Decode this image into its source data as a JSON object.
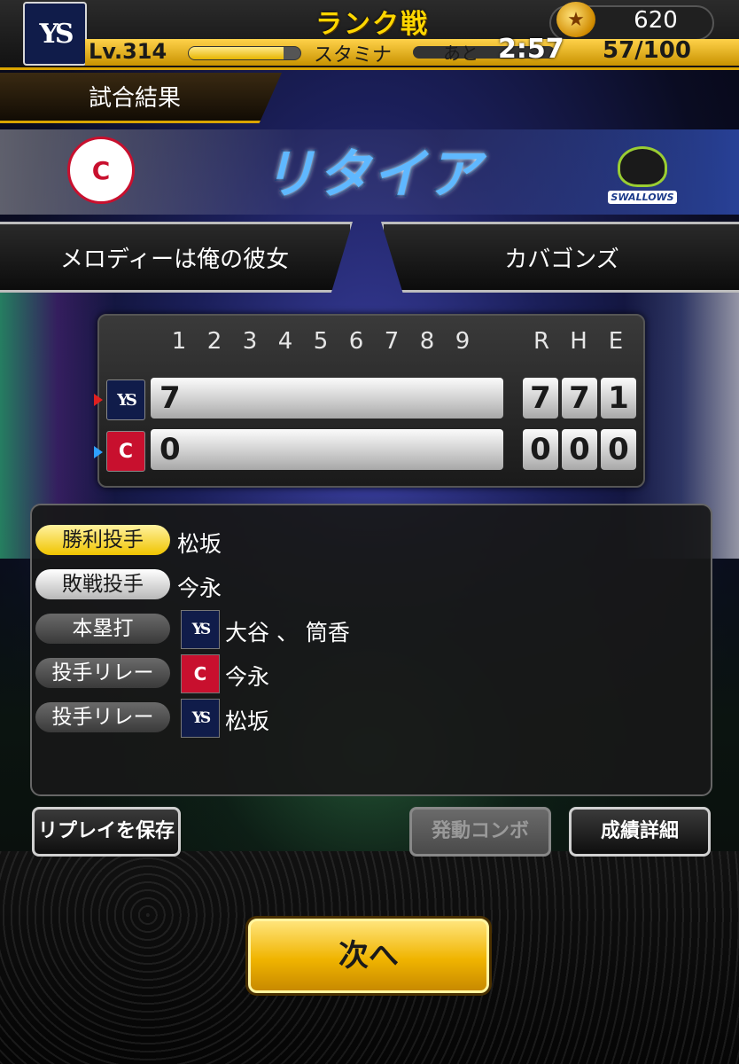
{
  "header": {
    "team_badge": "YS",
    "mode_title": "ランク戦",
    "coins": "620",
    "level_label": "Lv.314",
    "level_progress": 0.85,
    "stamina_label": "スタミナ",
    "stamina_remaining_label": "あと",
    "stamina_timer": "2:57",
    "stamina_count": "57/100"
  },
  "result": {
    "tab_label": "試合結果",
    "result_text": "リタイア",
    "home_team": "メロディーは俺の彼女",
    "away_team": "カバゴンズ",
    "carp_logo": "C",
    "swallows_logo_text": "SWALLOWS"
  },
  "scoreboard": {
    "innings": [
      "1",
      "2",
      "3",
      "4",
      "5",
      "6",
      "7",
      "8",
      "9"
    ],
    "rhe_headers": [
      "R",
      "H",
      "E"
    ],
    "rows": [
      {
        "logo": "YS",
        "line": "7",
        "rhe": [
          "7",
          "7",
          "1"
        ]
      },
      {
        "logo": "C",
        "line": "0",
        "rhe": [
          "0",
          "0",
          "0"
        ]
      }
    ]
  },
  "details": {
    "win_pitcher": {
      "label": "勝利投手",
      "player": "松坂"
    },
    "lose_pitcher": {
      "label": "敗戦投手",
      "player": "今永"
    },
    "home_run": {
      "label": "本塁打",
      "logo": "YS",
      "player": "大谷 、 筒香"
    },
    "relief_1": {
      "label": "投手リレー",
      "logo": "C",
      "player": "今永"
    },
    "relief_2": {
      "label": "投手リレー",
      "logo": "YS",
      "player": "松坂"
    }
  },
  "buttons": {
    "save_replay": "リプレイを保存",
    "combo": "発動コンボ",
    "stats_detail": "成績詳細",
    "next": "次へ"
  },
  "icons": {
    "coin": "coin-icon",
    "arrow_red": "red-triangle",
    "arrow_blue": "blue-triangle"
  }
}
